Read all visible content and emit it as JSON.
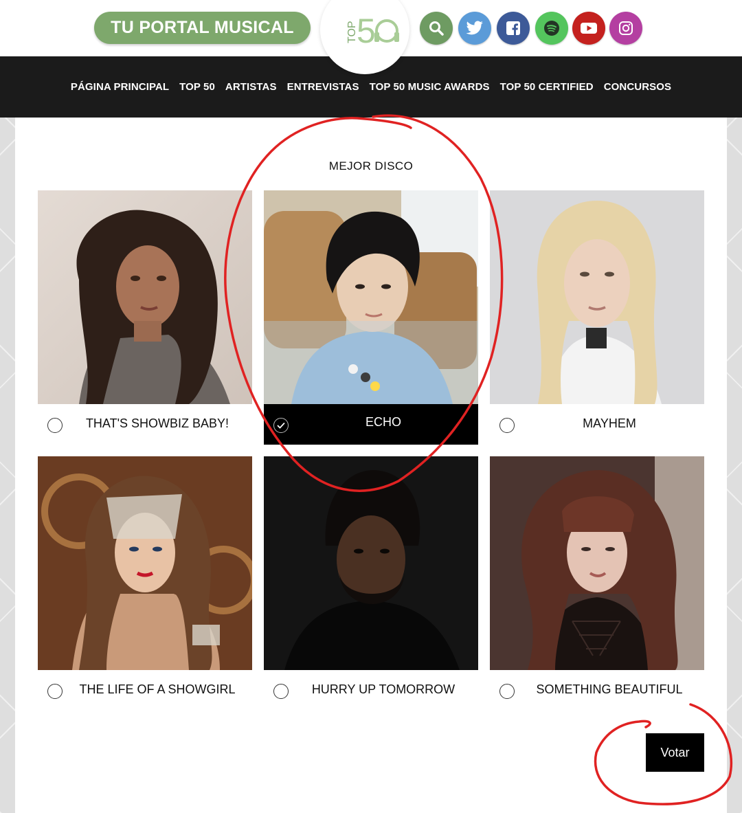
{
  "header": {
    "slogan": "TU PORTAL MUSICAL",
    "logo_text": "TOP50",
    "icons": [
      "search-icon",
      "twitter-icon",
      "facebook-icon",
      "spotify-icon",
      "youtube-icon",
      "instagram-icon"
    ]
  },
  "nav": {
    "items": [
      "PÁGINA PRINCIPAL",
      "TOP 50",
      "ARTISTAS",
      "ENTREVISTAS",
      "TOP 50 MUSIC AWARDS",
      "TOP 50 CERTIFIED",
      "CONCURSOS"
    ]
  },
  "poll": {
    "category": "MEJOR DISCO",
    "options": [
      {
        "label": "THAT'S SHOWBIZ BABY!",
        "selected": false
      },
      {
        "label": "ECHO",
        "selected": true
      },
      {
        "label": "MAYHEM",
        "selected": false
      },
      {
        "label": "THE LIFE OF A SHOWGIRL",
        "selected": false
      },
      {
        "label": "HURRY UP TOMORROW",
        "selected": false
      },
      {
        "label": "SOMETHING BEAUTIFUL",
        "selected": false
      }
    ],
    "vote_label": "Votar"
  },
  "colors": {
    "brand_green": "#7ea86c",
    "nav_bg": "#1b1b1b",
    "annotation_red": "#e02222"
  }
}
